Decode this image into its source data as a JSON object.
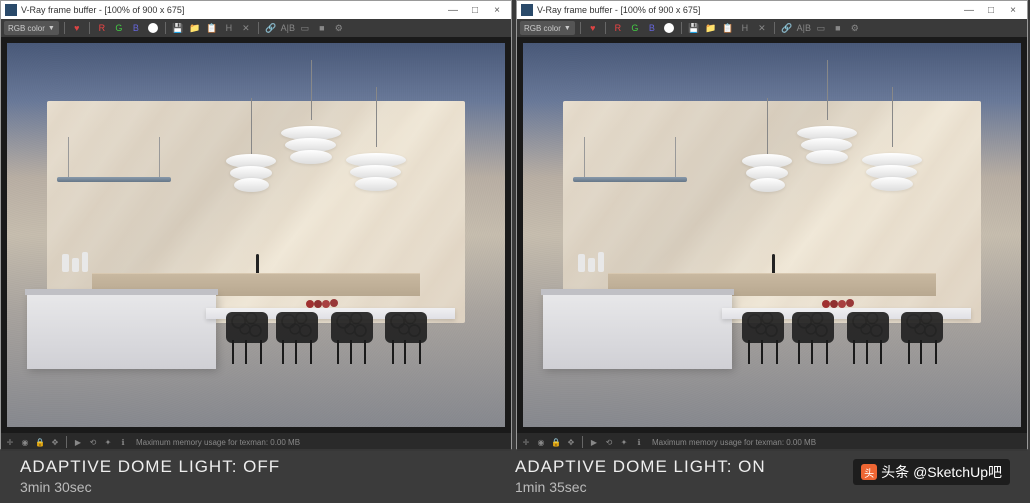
{
  "window": {
    "title": "V-Ray frame buffer - [100% of 900 x 675]",
    "minimize": "—",
    "maximize": "□",
    "close": "×"
  },
  "toolbar": {
    "channel_label": "RGB color",
    "icons": {
      "heart": "♥",
      "r": "R",
      "g": "G",
      "b": "B",
      "save": "💾",
      "open": "📁",
      "clipboard": "📋",
      "history": "H",
      "wipe": "✕",
      "link": "🔗",
      "ab": "A|B",
      "region": "▭",
      "stop": "■",
      "settings": "⚙"
    }
  },
  "statusbar": {
    "memory_text": "Maximum memory usage for texman: 0.00 MB"
  },
  "captions": {
    "left": {
      "title": "ADAPTIVE DOME LIGHT: OFF",
      "time": "3min 30sec"
    },
    "right": {
      "title": "ADAPTIVE DOME LIGHT: ON",
      "time": "1min 35sec"
    }
  },
  "watermark": {
    "prefix": "头条",
    "handle": "@SketchUp吧"
  }
}
